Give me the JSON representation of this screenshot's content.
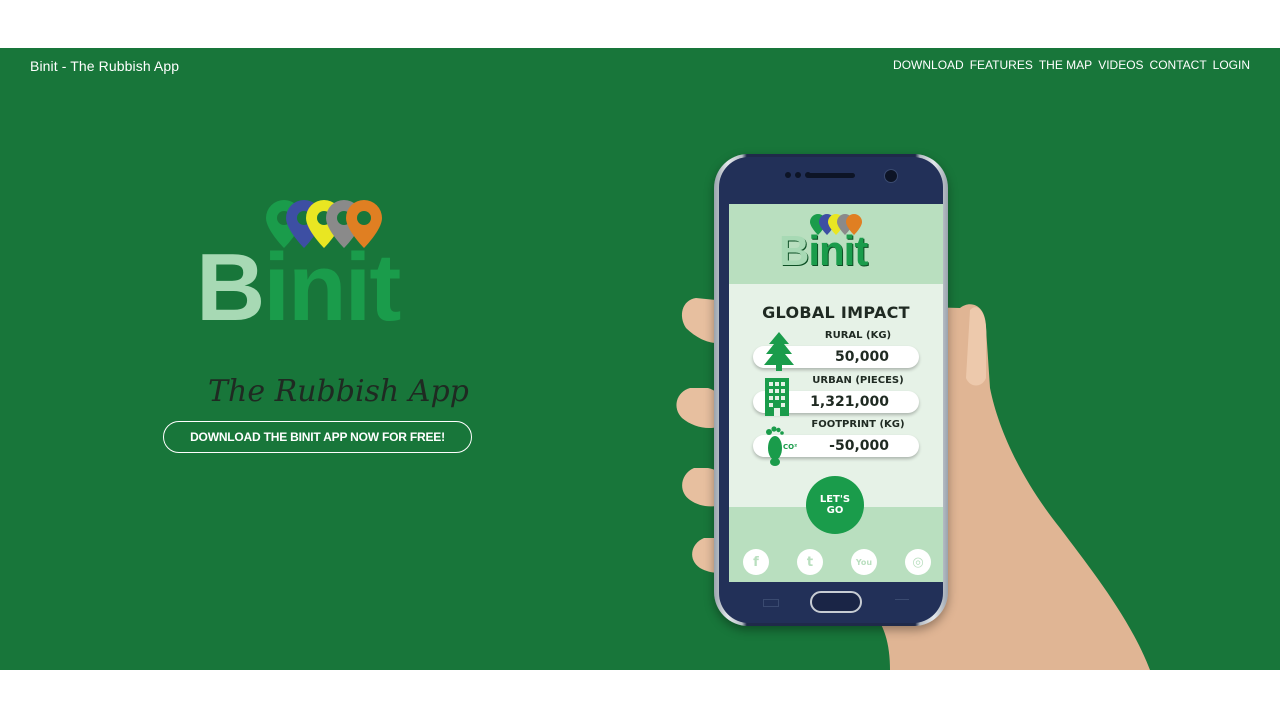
{
  "header": {
    "brand": "Binit - The Rubbish App",
    "nav": [
      "DOWNLOAD",
      "FEATURES",
      "THE MAP",
      "VIDEOS",
      "CONTACT",
      "LOGIN"
    ]
  },
  "hero": {
    "logo_word_first": "B",
    "logo_word_rest": "init",
    "tagline": "The Rubbish App",
    "cta_label": "DOWNLOAD THE BINIT APP NOW FOR FREE!"
  },
  "phone_app": {
    "logo_word_first": "B",
    "logo_word_rest": "init",
    "title": "GLOBAL IMPACT",
    "stats": [
      {
        "label": "RURAL (KG)",
        "value": "50,000",
        "icon": "tree-icon"
      },
      {
        "label": "URBAN (PIECES)",
        "value": "1,321,000",
        "icon": "building-icon"
      },
      {
        "label": "FOOTPRINT (KG)",
        "value": "-50,000",
        "icon": "footprint-icon"
      }
    ],
    "co2_mark": "CO²",
    "lets_go": "LET'S GO",
    "social": [
      {
        "name": "facebook-icon",
        "glyph": "f"
      },
      {
        "name": "twitter-icon",
        "glyph": "t"
      },
      {
        "name": "youtube-icon",
        "glyph": "You"
      },
      {
        "name": "instagram-icon",
        "glyph": "◎"
      }
    ]
  },
  "colors": {
    "hero_bg": "#18763a",
    "brand_green": "#1a9c4b",
    "light_green": "#b9dfbf",
    "pin_colors": [
      "#1a9c4b",
      "#3d4fa3",
      "#e9e622",
      "#8a8a8a",
      "#e07f22"
    ]
  }
}
